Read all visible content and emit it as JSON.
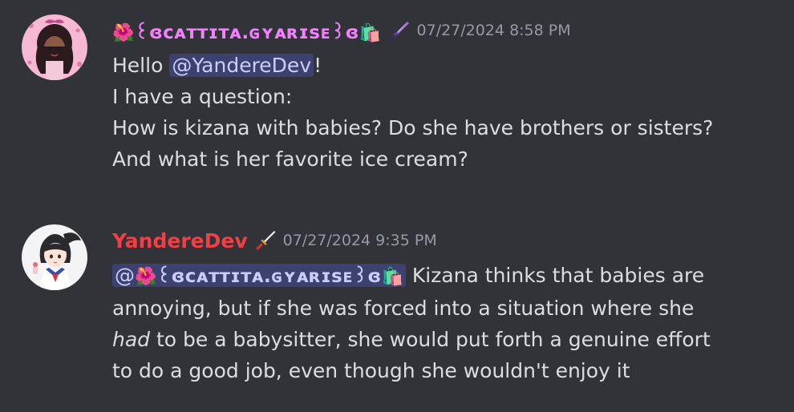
{
  "messages": [
    {
      "author": {
        "prefix_emoji": "🌺",
        "name": "꒰ɞᴄᴀᴛᴛɪᴛᴀ.ɢʏᴀʀɪsᴇ꒱ɞ",
        "suffix_emoji": "🛍️",
        "color": "#f47fff",
        "role_icon": "purple-knife-icon"
      },
      "timestamp": "07/27/2024 8:58 PM",
      "lines": {
        "l1_pre": "Hello ",
        "l1_mention": "@YandereDev",
        "l1_post": "!",
        "l2": "I have a question:",
        "l3": "How is kizana with babies? Do she have brothers or sisters?",
        "l4": "And what is her favorite ice cream?"
      }
    },
    {
      "author": {
        "name": "YandereDev",
        "color": "#f23f43",
        "role_icon": "katana-icon"
      },
      "timestamp": "07/27/2024 9:35 PM",
      "lines": {
        "mention_at": "@",
        "mention_prefix_emoji": "🌺",
        "mention_name": "꒰ɞᴄᴀᴛᴛɪᴛᴀ.ɢʏᴀʀɪsᴇ꒱ɞ",
        "mention_suffix_emoji": "🛍️",
        "l1_post": " Kizana thinks that babies are",
        "l2": "annoying, but if she was forced into a situation where she",
        "l3_italic": "had",
        "l3_post": " to be a babysitter, she would put forth a genuine effort",
        "l4": "to do a good job, even though she wouldn't enjoy it"
      }
    }
  ],
  "colors": {
    "background": "#313338",
    "text": "#dbdee1",
    "timestamp": "#949ba4",
    "mention_bg": "rgba(88,101,242,0.3)",
    "mention_text": "#c9cdfb"
  }
}
